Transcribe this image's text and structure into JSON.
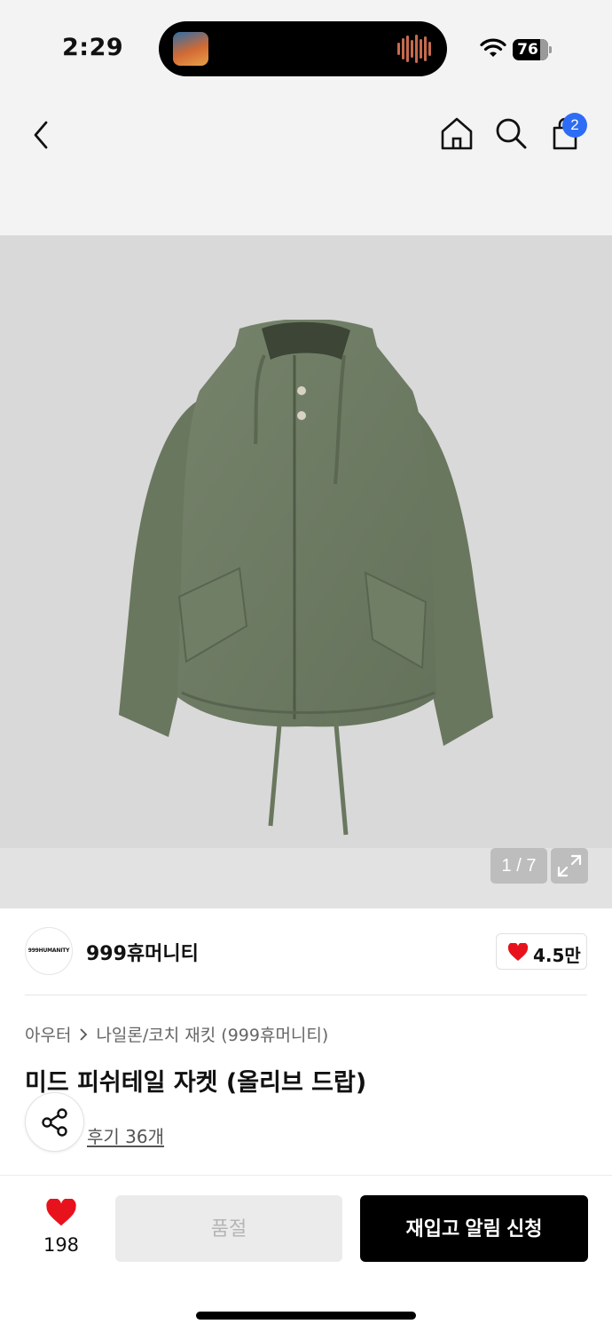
{
  "status_bar": {
    "time": "2:29",
    "battery": "76",
    "icons": [
      "now-playing-art-icon",
      "audio-waveform-icon",
      "wifi-icon",
      "battery-icon"
    ]
  },
  "nav": {
    "icons": [
      "back-arrow-icon",
      "home-icon",
      "search-icon",
      "shopping-bag-icon"
    ],
    "cart_count": "2",
    "badge_color": "#2d6df5"
  },
  "gallery": {
    "page_indicator": "1 / 7",
    "jacket_color": "#6d7a63",
    "background_color": "#d9d9d9"
  },
  "brand": {
    "logo_text": "999HUMANITY",
    "name": "999휴머니티",
    "likes": "4.5만"
  },
  "product": {
    "breadcrumb": [
      "아우터",
      "나일론/코치 재킷 (999휴머니티)"
    ],
    "title": "미드 피쉬테일 자켓 (올리브 드랍)",
    "reviews": "후기 36개"
  },
  "actions": {
    "wish_count": "198",
    "soldout_label": "품절",
    "restock_label": "재입고 알림 신청",
    "heart_color": "#e8121d"
  }
}
